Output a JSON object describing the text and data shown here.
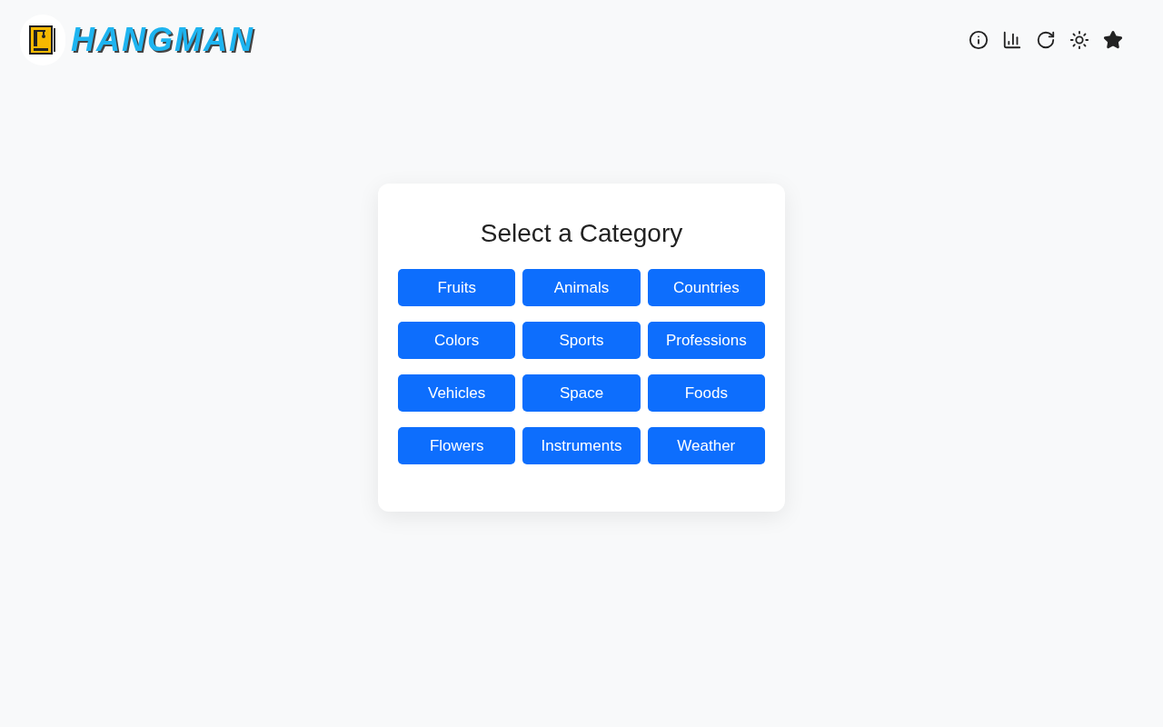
{
  "logo": {
    "title": "HANGMAN"
  },
  "toolbar": [
    {
      "kind": "info"
    },
    {
      "kind": "stats"
    },
    {
      "kind": "restart"
    },
    {
      "kind": "theme"
    },
    {
      "kind": "favorite"
    }
  ],
  "card": {
    "title": "Select a Category",
    "categories": [
      "Fruits",
      "Animals",
      "Countries",
      "Colors",
      "Sports",
      "Professions",
      "Vehicles",
      "Space",
      "Foods",
      "Flowers",
      "Instruments",
      "Weather"
    ]
  }
}
